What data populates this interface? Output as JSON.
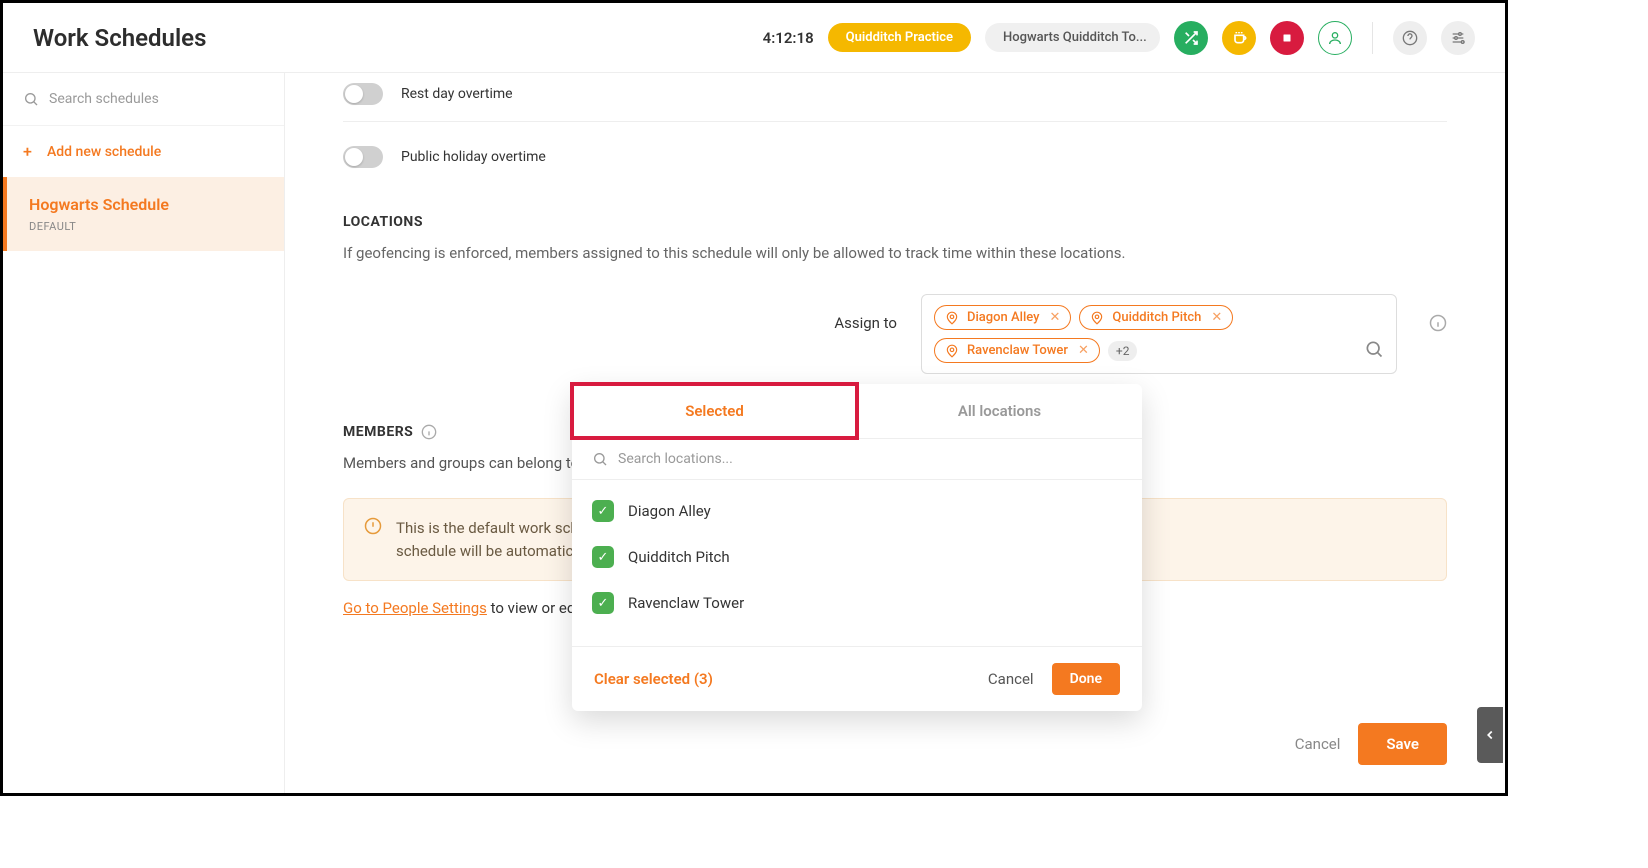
{
  "header": {
    "title": "Work Schedules",
    "time": "4:12:18",
    "pill_primary": "Quidditch Practice",
    "pill_secondary": "Hogwarts Quidditch To..."
  },
  "sidebar": {
    "search_placeholder": "Search schedules",
    "add_label": "Add new schedule",
    "items": [
      {
        "name": "Hogwarts Schedule",
        "tag": "DEFAULT"
      }
    ]
  },
  "main": {
    "toggles": {
      "rest_day": "Rest day overtime",
      "public_holiday": "Public holiday overtime"
    },
    "locations": {
      "heading": "LOCATIONS",
      "description": "If geofencing is enforced, members assigned to this schedule will only be allowed to track time within these locations.",
      "assign_label": "Assign to",
      "chips": [
        "Diagon Alley",
        "Quidditch Pitch",
        "Ravenclaw Tower"
      ],
      "more": "+2"
    },
    "members": {
      "heading": "MEMBERS",
      "description": "Members and groups can belong to o",
      "banner_line1": "This is the default work sched",
      "banner_line2": "schedule will be automatically",
      "people_link": "Go to People Settings",
      "people_suffix": " to view or edit M"
    },
    "footer": {
      "cancel": "Cancel",
      "save": "Save"
    }
  },
  "dropdown": {
    "tab_selected": "Selected",
    "tab_all": "All locations",
    "search_placeholder": "Search locations...",
    "items": [
      "Diagon Alley",
      "Quidditch Pitch",
      "Ravenclaw Tower"
    ],
    "clear": "Clear selected (3)",
    "cancel": "Cancel",
    "done": "Done"
  }
}
